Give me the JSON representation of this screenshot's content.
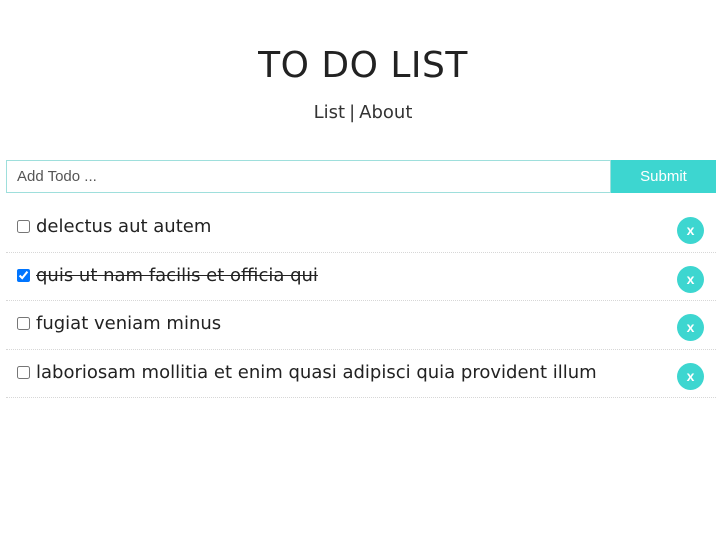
{
  "header": {
    "title": "TO DO LIST"
  },
  "nav": {
    "links": [
      "List",
      "About"
    ],
    "separator": "|"
  },
  "add_form": {
    "placeholder": "Add Todo ...",
    "value": "",
    "submit_label": "Submit"
  },
  "todos": [
    {
      "text": "delectus aut autem",
      "completed": false,
      "delete_label": "x"
    },
    {
      "text": "quis ut nam facilis et officia qui",
      "completed": true,
      "delete_label": "x"
    },
    {
      "text": "fugiat veniam minus",
      "completed": false,
      "delete_label": "x"
    },
    {
      "text": "laboriosam mollitia et enim quasi adipisci quia provident illum",
      "completed": false,
      "delete_label": "x"
    }
  ],
  "colors": {
    "accent": "#3dd6d0",
    "input_border": "#9edfdc",
    "text": "#222222"
  }
}
